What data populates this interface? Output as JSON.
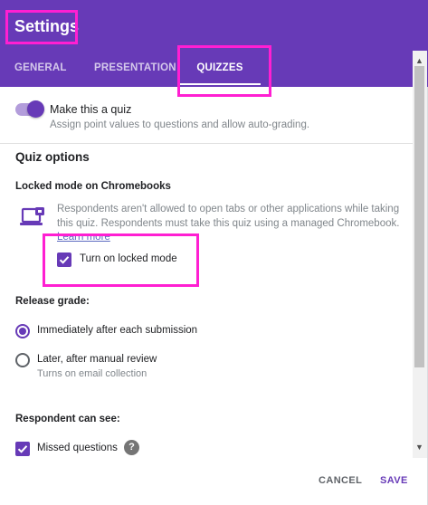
{
  "header": {
    "title": "Settings",
    "tabs": [
      {
        "label": "GENERAL",
        "active": false
      },
      {
        "label": "PRESENTATION",
        "active": false
      },
      {
        "label": "QUIZZES",
        "active": true
      }
    ]
  },
  "quiz_toggle": {
    "label": "Make this a quiz",
    "description": "Assign point values to questions and allow auto-grading.",
    "on": true
  },
  "quiz_options": {
    "heading": "Quiz options",
    "locked_mode": {
      "heading": "Locked mode on Chromebooks",
      "icon": "laptop-icon",
      "description": "Respondents aren't allowed to open tabs or other applications while taking this quiz. Respondents must take this quiz using a managed Chromebook.",
      "learn_more": "Learn more",
      "checkbox_label": "Turn on locked mode",
      "checked": true
    },
    "release_grade": {
      "heading": "Release grade:",
      "options": [
        {
          "label": "Immediately after each submission",
          "selected": true
        },
        {
          "label": "Later, after manual review",
          "sublabel": "Turns on email collection",
          "selected": false
        }
      ]
    },
    "respondent_can_see": {
      "heading": "Respondent can see:",
      "items": [
        {
          "label": "Missed questions",
          "checked": true,
          "help_icon": "help-icon"
        }
      ]
    }
  },
  "footer": {
    "cancel": "CANCEL",
    "save": "SAVE"
  },
  "colors": {
    "accent": "#673ab7",
    "annotation": "#ff1fd2"
  }
}
